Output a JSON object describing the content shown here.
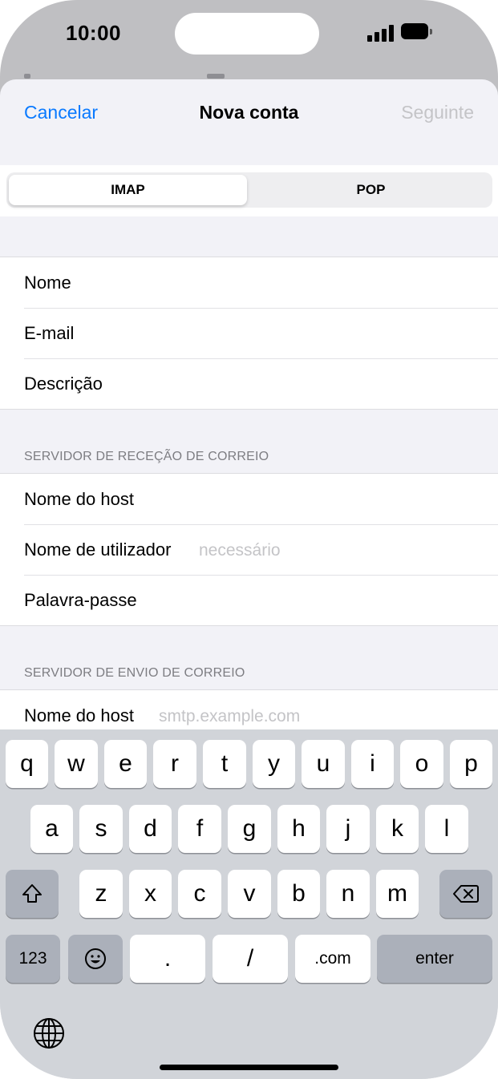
{
  "status_bar": {
    "time": "10:00",
    "icons": [
      "signal-icon",
      "battery-icon"
    ]
  },
  "nav": {
    "cancel": "Cancelar",
    "title": "Nova conta",
    "next": "Seguinte"
  },
  "segment": {
    "options": [
      "IMAP",
      "POP"
    ],
    "selected": "IMAP"
  },
  "account": {
    "name_label": "Nome",
    "email_label": "E-mail",
    "description_label": "Descrição"
  },
  "incoming": {
    "header": "SERVIDOR DE RECEÇÃO DE CORREIO",
    "host_label": "Nome do host",
    "user_label": "Nome de utilizador",
    "user_placeholder": "necessário",
    "password_label": "Palavra-passe"
  },
  "outgoing": {
    "header": "SERVIDOR DE ENVIO DE CORREIO",
    "host_label": "Nome do host",
    "host_placeholder": "smtp.example.com"
  },
  "keyboard": {
    "row1": [
      "q",
      "w",
      "e",
      "r",
      "t",
      "y",
      "u",
      "i",
      "o",
      "p"
    ],
    "row2": [
      "a",
      "s",
      "d",
      "f",
      "g",
      "h",
      "j",
      "k",
      "l"
    ],
    "row3": [
      "z",
      "x",
      "c",
      "v",
      "b",
      "n",
      "m"
    ],
    "numbers": "123",
    "dot": ".",
    "slash": "/",
    "dotcom": ".com",
    "enter": "enter",
    "icons": [
      "shift-icon",
      "backspace-icon",
      "emoji-icon",
      "globe-icon"
    ]
  },
  "colors": {
    "accent": "#0a7aff",
    "disabled": "#c4c4c7",
    "keyboard_bg": "#d1d4d9"
  }
}
